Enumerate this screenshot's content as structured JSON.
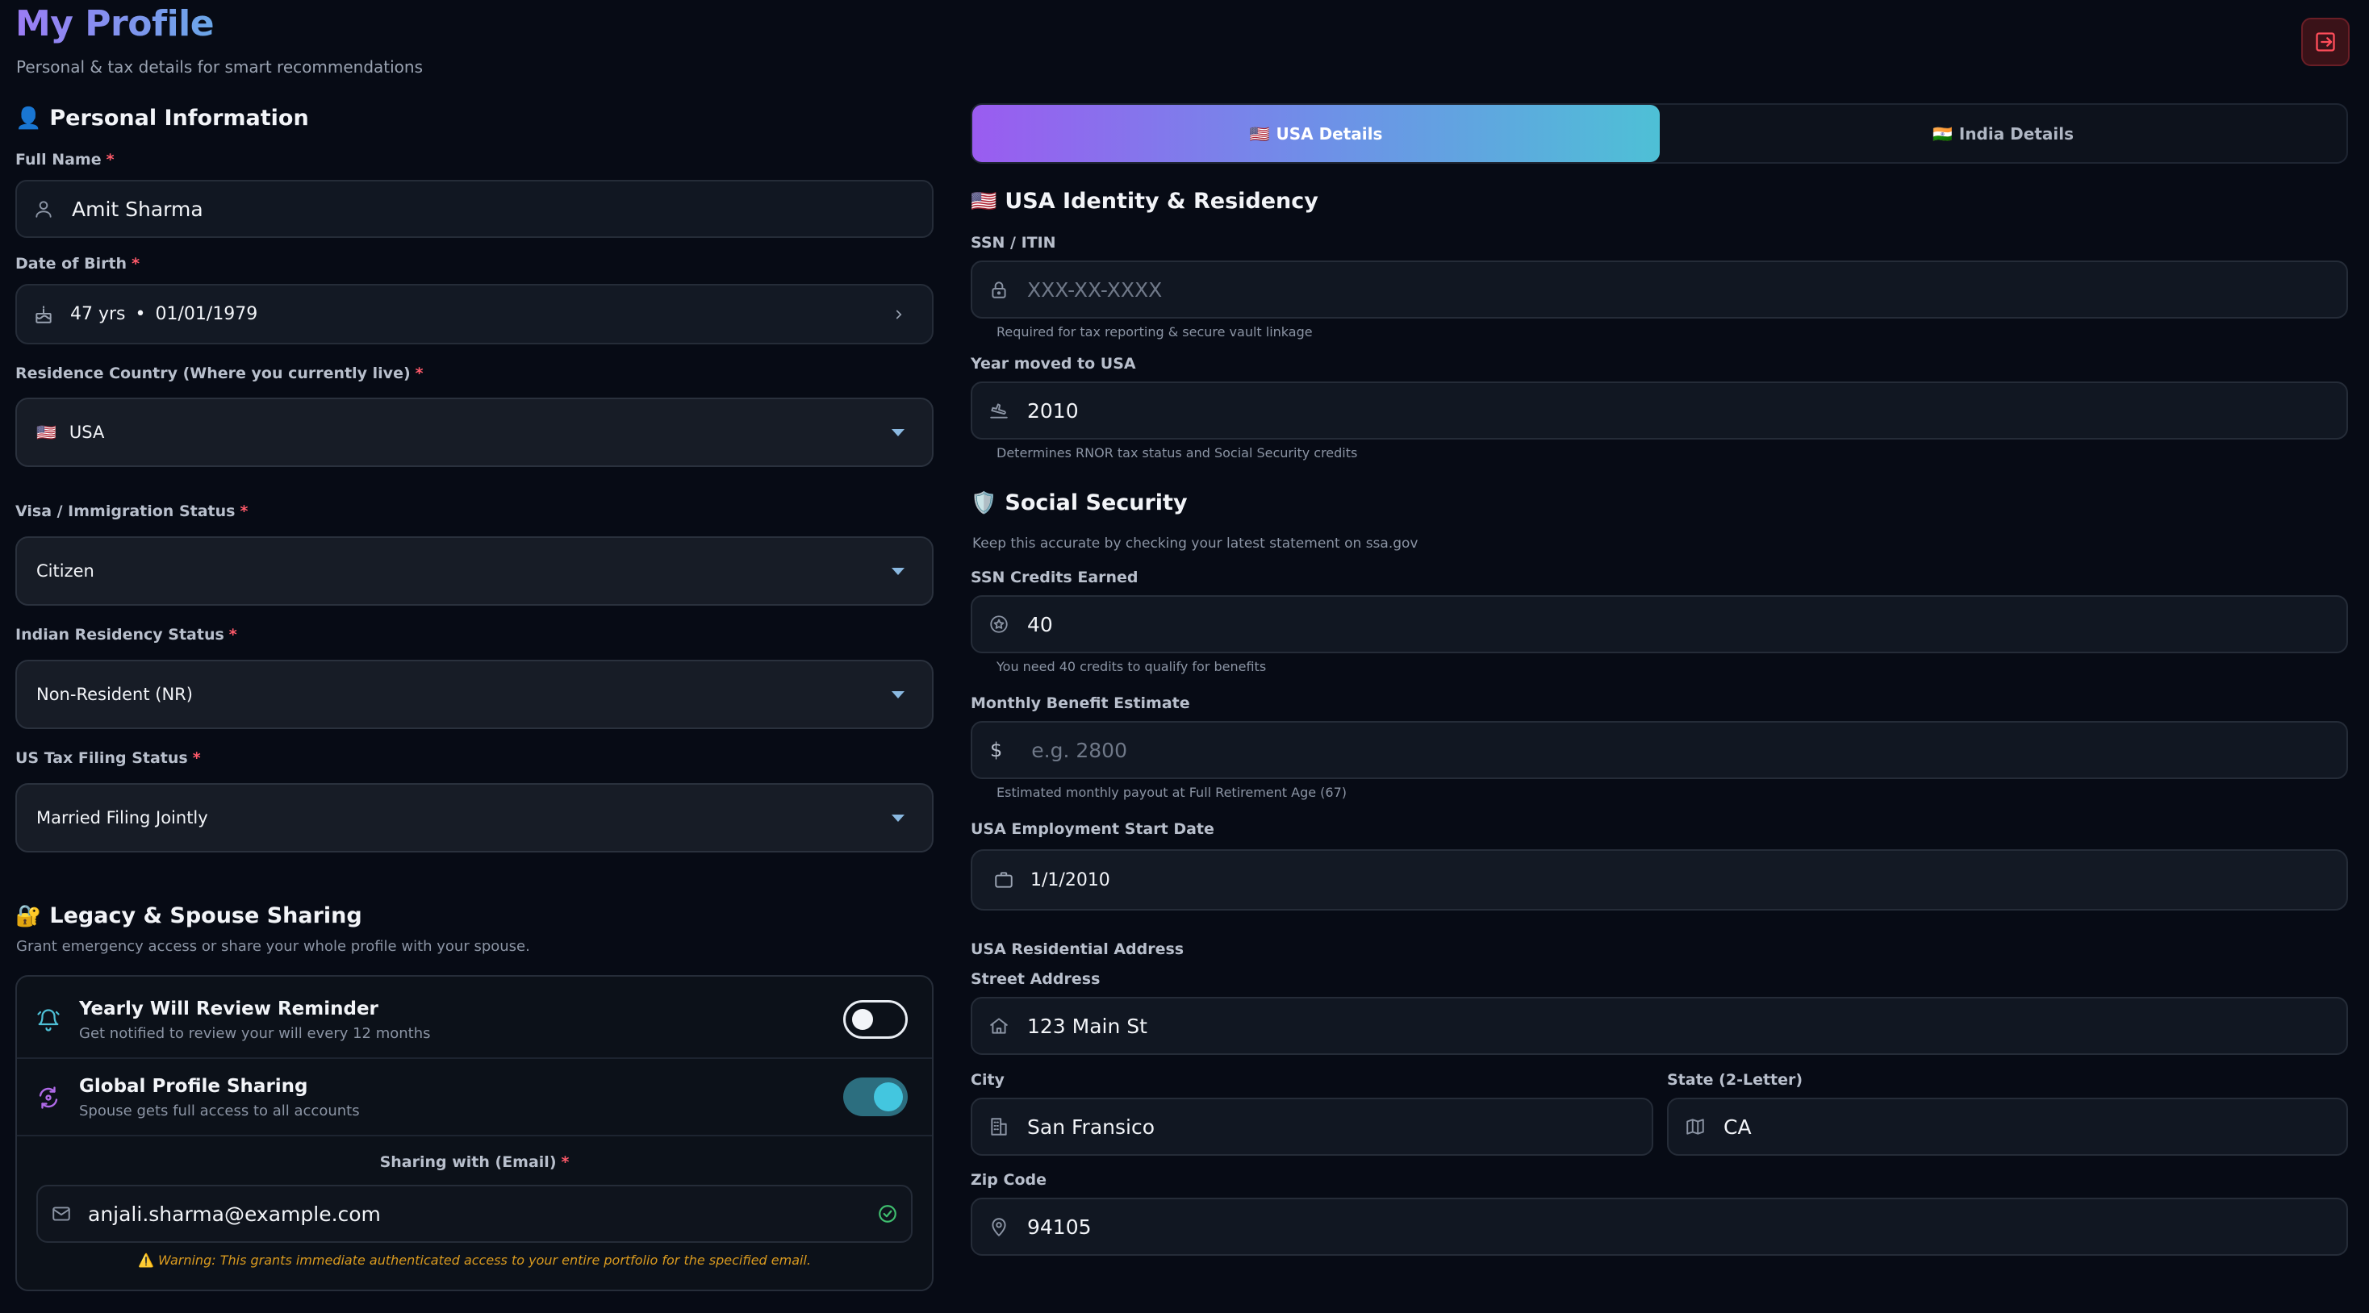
{
  "header": {
    "title": "My Profile",
    "subtitle": "Personal & tax details for smart recommendations",
    "logout_icon": "logout-icon"
  },
  "personal": {
    "title": "Personal Information",
    "title_emoji": "👤",
    "full_name": {
      "label": "Full Name",
      "value": "Amit Sharma",
      "icon": "user-icon"
    },
    "dob": {
      "label": "Date of Birth",
      "age": "47 yrs",
      "separator": "•",
      "date": "01/01/1979",
      "icon": "cake-icon"
    },
    "residence_country": {
      "label": "Residence Country (Where you currently live)",
      "flag": "🇺🇸",
      "value": "USA"
    },
    "visa_status": {
      "label": "Visa / Immigration Status",
      "value": "Citizen"
    },
    "indian_residency": {
      "label": "Indian Residency Status",
      "value": "Non-Resident (NR)"
    },
    "us_tax_filing": {
      "label": "US Tax Filing Status",
      "value": "Married Filing Jointly"
    },
    "required_mark": "*"
  },
  "legacy": {
    "title": "Legacy & Spouse Sharing",
    "title_emoji": "🔐",
    "subtitle": "Grant emergency access or share your whole profile with your spouse.",
    "will_reminder": {
      "title": "Yearly Will Review Reminder",
      "subtitle": "Get notified to review your will every 12 months",
      "enabled": false,
      "icon": "bell-icon"
    },
    "global_sharing": {
      "title": "Global Profile Sharing",
      "subtitle": "Spouse gets full access to all accounts",
      "enabled": true,
      "icon": "share-icon"
    },
    "sharing_email": {
      "label": "Sharing with (Email)",
      "value": "anjali.sharma@example.com",
      "icon": "mail-icon",
      "status_icon": "check-circle-icon"
    },
    "warning": "Warning: This grants immediate authenticated access to your entire portfolio for the specified email.",
    "warning_emoji": "⚠️"
  },
  "tabs": {
    "usa": {
      "label": "USA Details",
      "flag": "🇺🇸",
      "active": true
    },
    "india": {
      "label": "India Details",
      "flag": "🇮🇳",
      "active": false
    }
  },
  "usa_identity": {
    "title": "USA Identity & Residency",
    "title_emoji": "🇺🇸",
    "ssn": {
      "label": "SSN / ITIN",
      "placeholder": "XXX-XX-XXXX",
      "hint": "Required for tax reporting & secure vault linkage",
      "icon": "lock-icon"
    },
    "year_moved": {
      "label": "Year moved to USA",
      "value": "2010",
      "hint": "Determines RNOR tax status and Social Security credits",
      "icon": "plane-landing-icon"
    }
  },
  "social_security": {
    "title": "Social Security",
    "title_emoji": "🛡️",
    "subtitle": "Keep this accurate by checking your latest statement on ssa.gov",
    "credits": {
      "label": "SSN Credits Earned",
      "value": "40",
      "hint": "You need 40 credits to qualify for benefits",
      "icon": "star-badge-icon"
    },
    "benefit": {
      "label": "Monthly Benefit Estimate",
      "prefix": "$",
      "placeholder": "e.g. 2800",
      "hint": "Estimated monthly payout at Full Retirement Age (67)"
    },
    "employment_start": {
      "label": "USA Employment Start Date",
      "value": "1/1/2010",
      "icon": "briefcase-icon"
    }
  },
  "address": {
    "title": "USA Residential Address",
    "street": {
      "label": "Street Address",
      "value": "123 Main St",
      "icon": "home-icon"
    },
    "city": {
      "label": "City",
      "value": "San Fransico",
      "icon": "building-icon"
    },
    "state": {
      "label": "State (2-Letter)",
      "value": "CA",
      "icon": "map-icon"
    },
    "zip": {
      "label": "Zip Code",
      "value": "94105",
      "icon": "map-pin-icon"
    }
  },
  "colors": {
    "background": "#070b15",
    "accent_purple": "#9a5cf0",
    "accent_cyan": "#4ec0d6",
    "required": "#ff5a6a",
    "warning": "#d99a1f",
    "success": "#3fbf6f",
    "danger": "#ff4d5a"
  }
}
